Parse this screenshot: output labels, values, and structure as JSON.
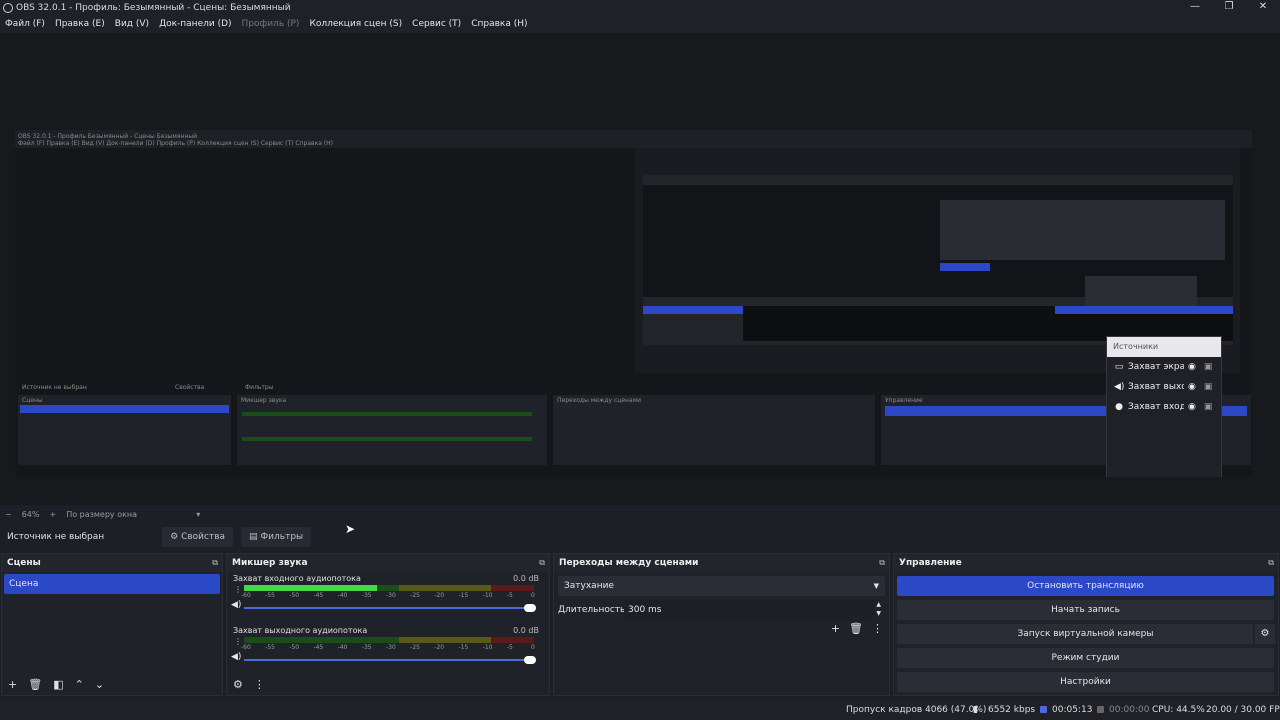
{
  "window": {
    "title": "OBS 32.0.1 - Профиль: Безымянный - Сцены: Безымянный",
    "controls": [
      "—",
      "❐",
      "✕"
    ]
  },
  "menu": [
    {
      "label": "Файл (F)",
      "enabled": true
    },
    {
      "label": "Правка (E)",
      "enabled": true
    },
    {
      "label": "Вид (V)",
      "enabled": true
    },
    {
      "label": "Док-панели (D)",
      "enabled": true
    },
    {
      "label": "Профиль (P)",
      "enabled": false
    },
    {
      "label": "Коллекция сцен (S)",
      "enabled": true
    },
    {
      "label": "Сервис (T)",
      "enabled": true
    },
    {
      "label": "Справка (H)",
      "enabled": true
    }
  ],
  "sources_popup": {
    "header": "Источники",
    "items": [
      {
        "icon": "monitor-icon",
        "name": "Захват экрана"
      },
      {
        "icon": "speaker-icon",
        "name": "Захват выходного аудиопотока"
      },
      {
        "icon": "mic-icon",
        "name": "Захват входного аудиопотока"
      }
    ]
  },
  "zoom": {
    "minus": "−",
    "value": "64%",
    "plus": "+",
    "mode": "По размеру окна"
  },
  "source_bar": {
    "label": "Источник не выбран",
    "properties": "Свойства",
    "filters": "Фильтры"
  },
  "scenes": {
    "title": "Сцены",
    "items": [
      "Сцена"
    ]
  },
  "mixer": {
    "title": "Микшер звука",
    "channels": [
      {
        "name": "Захват входного аудиопотока",
        "db": "0.0 dB",
        "level": 0.46
      },
      {
        "name": "Захват выходного аудиопотока",
        "db": "0.0 dB",
        "level": 0.0
      }
    ],
    "ticks": [
      "-60",
      "-55",
      "-50",
      "-45",
      "-40",
      "-35",
      "-30",
      "-25",
      "-20",
      "-15",
      "-10",
      "-5",
      "0"
    ]
  },
  "transitions": {
    "title": "Переходы между сценами",
    "type": "Затухание",
    "duration_label": "Длительность",
    "duration": "300 ms"
  },
  "controls": {
    "title": "Управление",
    "buttons": [
      "Остановить трансляцию",
      "Начать запись",
      "Запуск виртуальной камеры",
      "Режим студии",
      "Настройки"
    ]
  },
  "status": {
    "dropped": "Пропуск кадров 4066 (47.0%)",
    "bitrate": "6552 kbps",
    "stream_time": "00:05:13",
    "rec_time": "00:00:00",
    "cpu": "CPU: 44.5%",
    "fps": "20.00 / 30.00 FPS"
  },
  "colors": {
    "accent": "#2b48c7",
    "meter_green": "#46d846",
    "bg": "#1d1f26"
  }
}
